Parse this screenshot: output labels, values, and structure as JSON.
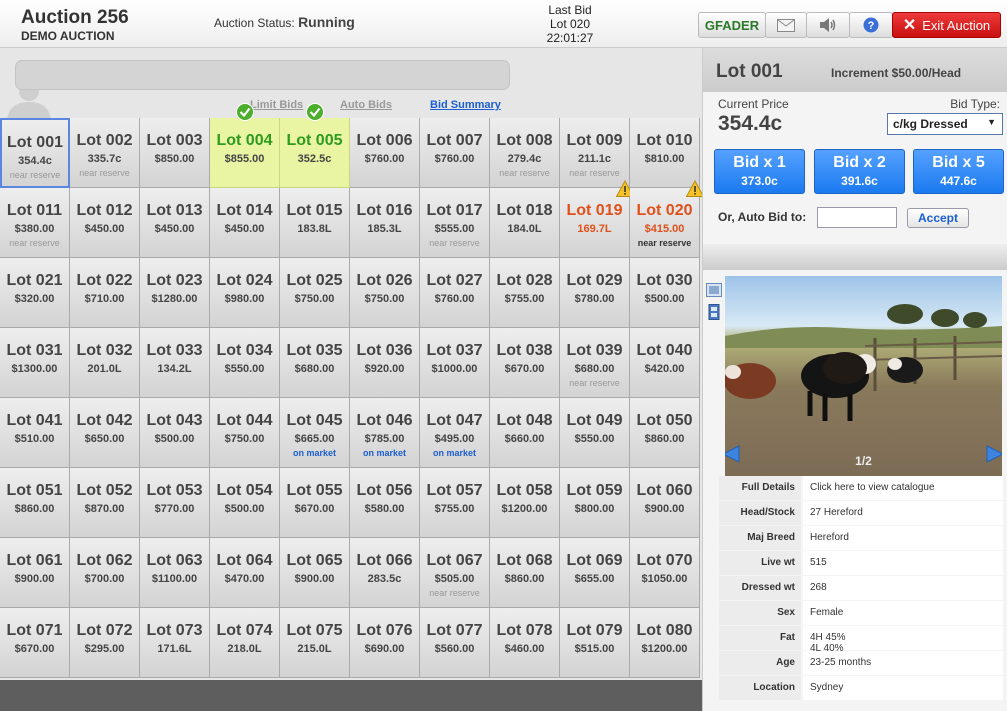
{
  "header": {
    "title": "Auction 256",
    "subtitle": "DEMO AUCTION",
    "status_label": "Auction Status:",
    "status_value": "Running",
    "last_bid_label": "Last Bid",
    "last_bid_lot": "Lot 020",
    "last_bid_time": "22:01:27",
    "gfader_label": "GFADER",
    "exit_label": "Exit Auction",
    "icons": [
      "mail-icon",
      "speaker-icon",
      "help-icon",
      "close-icon"
    ]
  },
  "tabs": {
    "limit_bids": "Limit Bids",
    "auto_bids": "Auto Bids",
    "bid_summary": "Bid Summary"
  },
  "lots": [
    {
      "name": "Lot 001",
      "price": "354.4c",
      "note": "near reserve",
      "state": "selected"
    },
    {
      "name": "Lot 002",
      "price": "335.7c",
      "note": "near reserve",
      "state": "normal"
    },
    {
      "name": "Lot 003",
      "price": "$850.00",
      "note": "",
      "state": "normal"
    },
    {
      "name": "Lot 004",
      "price": "$855.00",
      "note": "",
      "state": "leading"
    },
    {
      "name": "Lot 005",
      "price": "352.5c",
      "note": "",
      "state": "leading"
    },
    {
      "name": "Lot 006",
      "price": "$760.00",
      "note": "",
      "state": "normal"
    },
    {
      "name": "Lot 007",
      "price": "$760.00",
      "note": "",
      "state": "normal"
    },
    {
      "name": "Lot 008",
      "price": "279.4c",
      "note": "near reserve",
      "state": "normal"
    },
    {
      "name": "Lot 009",
      "price": "211.1c",
      "note": "near reserve",
      "state": "normal"
    },
    {
      "name": "Lot 010",
      "price": "$810.00",
      "note": "",
      "state": "normal"
    },
    {
      "name": "Lot 011",
      "price": "$380.00",
      "note": "near reserve",
      "state": "normal"
    },
    {
      "name": "Lot 012",
      "price": "$450.00",
      "note": "",
      "state": "normal"
    },
    {
      "name": "Lot 013",
      "price": "$450.00",
      "note": "",
      "state": "normal"
    },
    {
      "name": "Lot 014",
      "price": "$450.00",
      "note": "",
      "state": "normal"
    },
    {
      "name": "Lot 015",
      "price": "183.8L",
      "note": "",
      "state": "normal"
    },
    {
      "name": "Lot 016",
      "price": "185.3L",
      "note": "",
      "state": "normal"
    },
    {
      "name": "Lot 017",
      "price": "$555.00",
      "note": "near reserve",
      "state": "normal"
    },
    {
      "name": "Lot 018",
      "price": "184.0L",
      "note": "",
      "state": "normal"
    },
    {
      "name": "Lot 019",
      "price": "169.7L",
      "note": "",
      "state": "warning"
    },
    {
      "name": "Lot 020",
      "price": "$415.00",
      "note": "near reserve",
      "state": "warning"
    },
    {
      "name": "Lot 021",
      "price": "$320.00",
      "note": "",
      "state": "normal"
    },
    {
      "name": "Lot 022",
      "price": "$710.00",
      "note": "",
      "state": "normal"
    },
    {
      "name": "Lot 023",
      "price": "$1280.00",
      "note": "",
      "state": "normal"
    },
    {
      "name": "Lot 024",
      "price": "$980.00",
      "note": "",
      "state": "normal"
    },
    {
      "name": "Lot 025",
      "price": "$750.00",
      "note": "",
      "state": "normal"
    },
    {
      "name": "Lot 026",
      "price": "$750.00",
      "note": "",
      "state": "normal"
    },
    {
      "name": "Lot 027",
      "price": "$760.00",
      "note": "",
      "state": "normal"
    },
    {
      "name": "Lot 028",
      "price": "$755.00",
      "note": "",
      "state": "normal"
    },
    {
      "name": "Lot 029",
      "price": "$780.00",
      "note": "",
      "state": "normal"
    },
    {
      "name": "Lot 030",
      "price": "$500.00",
      "note": "",
      "state": "normal"
    },
    {
      "name": "Lot 031",
      "price": "$1300.00",
      "note": "",
      "state": "normal"
    },
    {
      "name": "Lot 032",
      "price": "201.0L",
      "note": "",
      "state": "normal"
    },
    {
      "name": "Lot 033",
      "price": "134.2L",
      "note": "",
      "state": "normal"
    },
    {
      "name": "Lot 034",
      "price": "$550.00",
      "note": "",
      "state": "normal"
    },
    {
      "name": "Lot 035",
      "price": "$680.00",
      "note": "",
      "state": "normal"
    },
    {
      "name": "Lot 036",
      "price": "$920.00",
      "note": "",
      "state": "normal"
    },
    {
      "name": "Lot 037",
      "price": "$1000.00",
      "note": "",
      "state": "normal"
    },
    {
      "name": "Lot 038",
      "price": "$670.00",
      "note": "",
      "state": "normal"
    },
    {
      "name": "Lot 039",
      "price": "$680.00",
      "note": "near reserve",
      "state": "normal"
    },
    {
      "name": "Lot 040",
      "price": "$420.00",
      "note": "",
      "state": "normal"
    },
    {
      "name": "Lot 041",
      "price": "$510.00",
      "note": "",
      "state": "normal"
    },
    {
      "name": "Lot 042",
      "price": "$650.00",
      "note": "",
      "state": "normal"
    },
    {
      "name": "Lot 043",
      "price": "$500.00",
      "note": "",
      "state": "normal"
    },
    {
      "name": "Lot 044",
      "price": "$750.00",
      "note": "",
      "state": "normal"
    },
    {
      "name": "Lot 045",
      "price": "$665.00",
      "note": "on market",
      "state": "normal"
    },
    {
      "name": "Lot 046",
      "price": "$785.00",
      "note": "on market",
      "state": "normal"
    },
    {
      "name": "Lot 047",
      "price": "$495.00",
      "note": "on market",
      "state": "normal"
    },
    {
      "name": "Lot 048",
      "price": "$660.00",
      "note": "",
      "state": "normal"
    },
    {
      "name": "Lot 049",
      "price": "$550.00",
      "note": "",
      "state": "normal"
    },
    {
      "name": "Lot 050",
      "price": "$860.00",
      "note": "",
      "state": "normal"
    },
    {
      "name": "Lot 051",
      "price": "$860.00",
      "note": "",
      "state": "normal"
    },
    {
      "name": "Lot 052",
      "price": "$870.00",
      "note": "",
      "state": "normal"
    },
    {
      "name": "Lot 053",
      "price": "$770.00",
      "note": "",
      "state": "normal"
    },
    {
      "name": "Lot 054",
      "price": "$500.00",
      "note": "",
      "state": "normal"
    },
    {
      "name": "Lot 055",
      "price": "$670.00",
      "note": "",
      "state": "normal"
    },
    {
      "name": "Lot 056",
      "price": "$580.00",
      "note": "",
      "state": "normal"
    },
    {
      "name": "Lot 057",
      "price": "$755.00",
      "note": "",
      "state": "normal"
    },
    {
      "name": "Lot 058",
      "price": "$1200.00",
      "note": "",
      "state": "normal"
    },
    {
      "name": "Lot 059",
      "price": "$800.00",
      "note": "",
      "state": "normal"
    },
    {
      "name": "Lot 060",
      "price": "$900.00",
      "note": "",
      "state": "normal"
    },
    {
      "name": "Lot 061",
      "price": "$900.00",
      "note": "",
      "state": "normal"
    },
    {
      "name": "Lot 062",
      "price": "$700.00",
      "note": "",
      "state": "normal"
    },
    {
      "name": "Lot 063",
      "price": "$1100.00",
      "note": "",
      "state": "normal"
    },
    {
      "name": "Lot 064",
      "price": "$470.00",
      "note": "",
      "state": "normal"
    },
    {
      "name": "Lot 065",
      "price": "$900.00",
      "note": "",
      "state": "normal"
    },
    {
      "name": "Lot 066",
      "price": "283.5c",
      "note": "",
      "state": "normal"
    },
    {
      "name": "Lot 067",
      "price": "$505.00",
      "note": "near reserve",
      "state": "normal"
    },
    {
      "name": "Lot 068",
      "price": "$860.00",
      "note": "",
      "state": "normal"
    },
    {
      "name": "Lot 069",
      "price": "$655.00",
      "note": "",
      "state": "normal"
    },
    {
      "name": "Lot 070",
      "price": "$1050.00",
      "note": "",
      "state": "normal"
    },
    {
      "name": "Lot 071",
      "price": "$670.00",
      "note": "",
      "state": "normal"
    },
    {
      "name": "Lot 072",
      "price": "$295.00",
      "note": "",
      "state": "normal"
    },
    {
      "name": "Lot 073",
      "price": "171.6L",
      "note": "",
      "state": "normal"
    },
    {
      "name": "Lot 074",
      "price": "218.0L",
      "note": "",
      "state": "normal"
    },
    {
      "name": "Lot 075",
      "price": "215.0L",
      "note": "",
      "state": "normal"
    },
    {
      "name": "Lot 076",
      "price": "$690.00",
      "note": "",
      "state": "normal"
    },
    {
      "name": "Lot 077",
      "price": "$560.00",
      "note": "",
      "state": "normal"
    },
    {
      "name": "Lot 078",
      "price": "$460.00",
      "note": "",
      "state": "normal"
    },
    {
      "name": "Lot 079",
      "price": "$515.00",
      "note": "",
      "state": "normal"
    },
    {
      "name": "Lot 080",
      "price": "$1200.00",
      "note": "",
      "state": "normal"
    }
  ],
  "panel": {
    "lot_name": "Lot 001",
    "increment": "Increment $50.00/Head",
    "current_price_label": "Current Price",
    "current_price": "354.4c",
    "bid_type_label": "Bid Type:",
    "bid_type_value": "c/kg Dressed",
    "bids": [
      {
        "label": "Bid x 1",
        "value": "373.0c"
      },
      {
        "label": "Bid x 2",
        "value": "391.6c"
      },
      {
        "label": "Bid x 5",
        "value": "447.6c"
      }
    ],
    "auto_bid_label": "Or, Auto Bid to:",
    "auto_bid_value": "",
    "accept_label": "Accept",
    "photo_counter": "1/2",
    "details": [
      {
        "key": "Full Details",
        "value": "Click here to view catalogue"
      },
      {
        "key": "Head/Stock",
        "value": "27 Hereford"
      },
      {
        "key": "Maj Breed",
        "value": "Hereford"
      },
      {
        "key": "Live wt",
        "value": "515"
      },
      {
        "key": "Dressed wt",
        "value": "268"
      },
      {
        "key": "Sex",
        "value": "Female"
      },
      {
        "key": "Fat",
        "value": "4H 45%\n4L 40%"
      },
      {
        "key": "Age",
        "value": "23-25 months"
      },
      {
        "key": "Location",
        "value": "Sydney"
      }
    ]
  },
  "colors": {
    "leading_bg": "#eaf5a3",
    "leading_text": "#2e9a1e",
    "warning_text": "#e0501a",
    "bid_button": "#1b7af0",
    "exit_button": "#d81e1e",
    "link_blue": "#1b5fd1"
  }
}
